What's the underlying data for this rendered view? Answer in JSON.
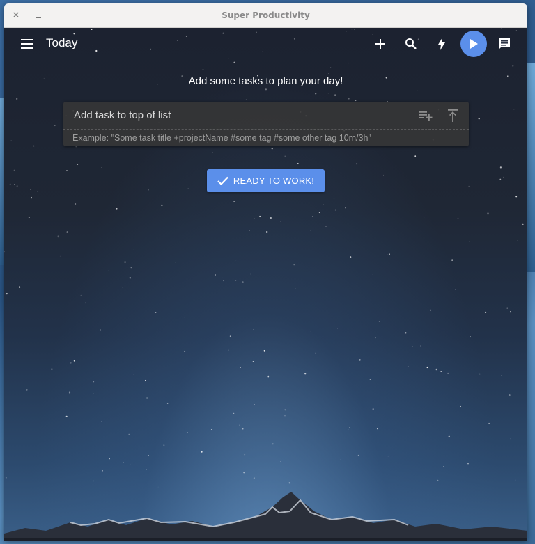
{
  "window": {
    "title": "Super Productivity",
    "close_icon": "close-icon",
    "minimize_icon": "minimize-icon"
  },
  "toolbar": {
    "menu_icon": "hamburger-menu-icon",
    "title": "Today",
    "actions": [
      {
        "icon": "plus-icon",
        "purpose": "add task"
      },
      {
        "icon": "search-icon",
        "purpose": "search"
      },
      {
        "icon": "lightning-bolt-icon",
        "purpose": "focus mode"
      },
      {
        "icon": "play-icon",
        "purpose": "start tracking"
      },
      {
        "icon": "comment-icon",
        "purpose": "notes"
      }
    ]
  },
  "main": {
    "plan_message": "Add some tasks to plan your day!",
    "add_task": {
      "placeholder": "Add task to top of list",
      "value": "",
      "hint": "Example: \"Some task title +projectName #some tag #some other tag 10m/3h\"",
      "icons": [
        "playlist-add-icon",
        "move-to-top-icon"
      ]
    },
    "ready_button": {
      "label": "READY TO WORK!",
      "icon": "check-icon"
    }
  },
  "colors": {
    "accent": "#5b8fea",
    "titlebar_bg": "#f3f2f1",
    "input_bg": "#373737"
  }
}
